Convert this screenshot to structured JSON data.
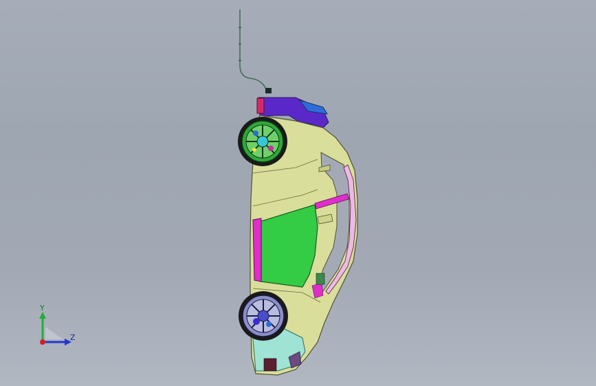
{
  "window": {
    "background_top": "#a6adb8",
    "background_bottom": "#b2b8c2"
  },
  "triad": {
    "y_label": "Y",
    "z_label": "Z",
    "y_color": "#1fae3a",
    "z_color": "#2038d0",
    "x_color": "#d0202a"
  },
  "model": {
    "icons": [
      "car-body",
      "wheel-front",
      "wheel-rear",
      "antenna-cable"
    ],
    "colors": {
      "body": "#d9de9a",
      "door": "#33cc44",
      "pillar": "#e02ecb",
      "hood": "#5a28c8",
      "bumper": "#9fe3d4",
      "wheel_front": "#1fa83a",
      "wheel_rear": "#4a4ccf"
    }
  }
}
